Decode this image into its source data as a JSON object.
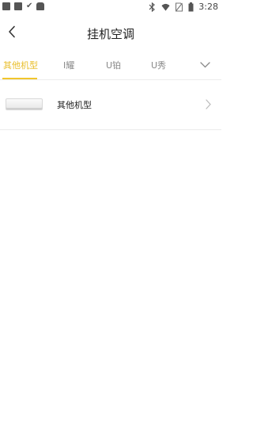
{
  "status_bar": {
    "time": "3:28",
    "icons": [
      "app-icon",
      "app-icon",
      "check-icon",
      "app-icon",
      "bluetooth-icon",
      "wifi-icon",
      "no-sim-icon",
      "battery-icon"
    ]
  },
  "header": {
    "back_icon": "chevron-left-icon",
    "title": "挂机空调"
  },
  "tabs": [
    {
      "label": "其他机型",
      "active": true
    },
    {
      "label": "I耀",
      "active": false
    },
    {
      "label": "U铂",
      "active": false
    },
    {
      "label": "U秀",
      "active": false
    }
  ],
  "tabs_more_icon": "chevron-down-icon",
  "accent_color": "#f1c62c",
  "list": [
    {
      "label": "其他机型",
      "thumbnail": "air-conditioner-image",
      "arrow_icon": "chevron-right-icon"
    }
  ]
}
